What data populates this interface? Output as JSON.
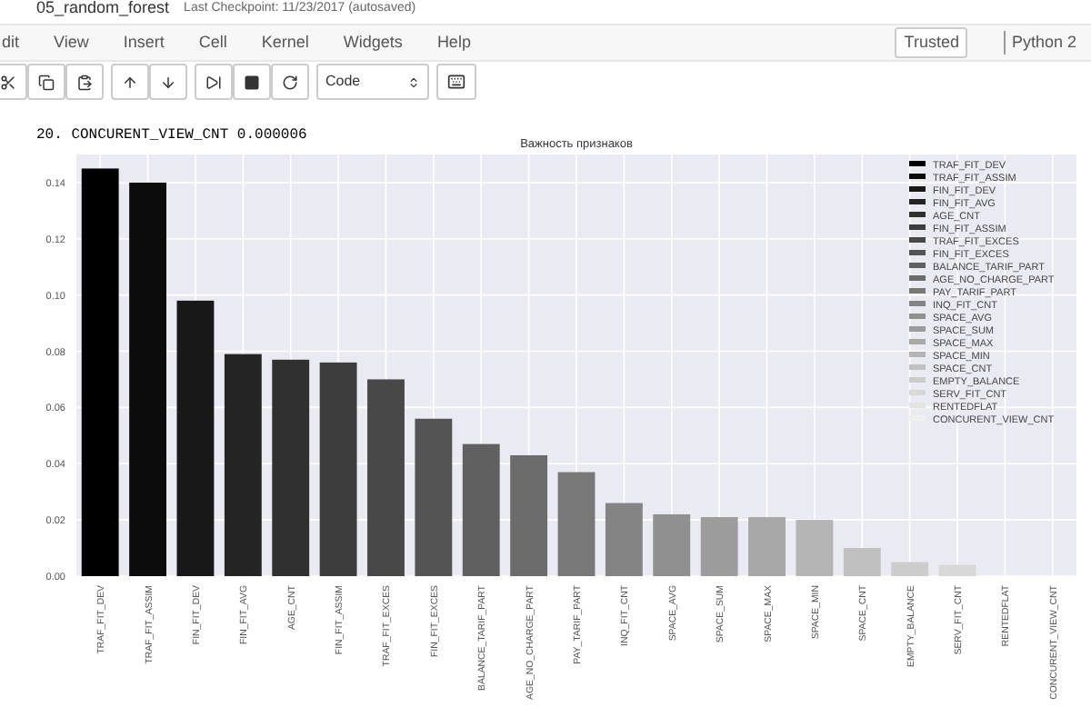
{
  "header": {
    "title": "05_random_forest",
    "checkpoint": "Last Checkpoint: 11/23/2017 (autosaved)"
  },
  "menu": [
    "dit",
    "View",
    "Insert",
    "Cell",
    "Kernel",
    "Widgets",
    "Help"
  ],
  "trusted": "Trusted",
  "kernel": "Python 2",
  "toolbar": {
    "cell_type": "Code"
  },
  "output": {
    "text": "20. CONCURENT_VIEW_CNT 0.000006",
    "chart_data": {
      "type": "bar",
      "title": "Важность признаков",
      "categories": [
        "TRAF_FIT_DEV",
        "TRAF_FIT_ASSIM",
        "FIN_FIT_DEV",
        "FIN_FIT_AVG",
        "AGE_CNT",
        "FIN_FIT_ASSIM",
        "TRAF_FIT_EXCES",
        "FIN_FIT_EXCES",
        "BALANCE_TARIF_PART",
        "AGE_NO_CHARGE_PART",
        "PAY_TARIF_PART",
        "INQ_FIT_CNT",
        "SPACE_AVG",
        "SPACE_SUM",
        "SPACE_MAX",
        "SPACE_MIN",
        "SPACE_CNT",
        "EMPTY_BALANCE",
        "SERV_FIT_CNT",
        "RENTEDFLAT",
        "CONCURENT_VIEW_CNT"
      ],
      "values": [
        0.145,
        0.14,
        0.098,
        0.079,
        0.077,
        0.076,
        0.07,
        0.056,
        0.047,
        0.043,
        0.037,
        0.026,
        0.022,
        0.021,
        0.021,
        0.02,
        0.01,
        0.005,
        0.004,
        0.0,
        0.0
      ],
      "grid": true,
      "colors": [
        "#000000",
        "#0c0c0c",
        "#181818",
        "#242424",
        "#303030",
        "#3c3c3c",
        "#484848",
        "#545454",
        "#606060",
        "#6c6c6c",
        "#787878",
        "#848484",
        "#909090",
        "#9c9c9c",
        "#a8a8a8",
        "#b4b4b4",
        "#c0c0c0",
        "#cccccc",
        "#d8d8d8",
        "#e4e4e4",
        "#f0f0f0"
      ],
      "ylim": [
        0,
        0.15
      ],
      "yticks": [
        {
          "value": 0,
          "label": "0.00"
        },
        {
          "value": 0.02,
          "label": "0.02"
        },
        {
          "value": 0.04,
          "label": "0.04"
        },
        {
          "value": 0.06,
          "label": "0.06"
        },
        {
          "value": 0.08,
          "label": "0.08"
        },
        {
          "value": 0.1,
          "label": "0.10"
        },
        {
          "value": 0.12,
          "label": "0.12"
        },
        {
          "value": 0.14,
          "label": "0.14"
        }
      ]
    }
  }
}
